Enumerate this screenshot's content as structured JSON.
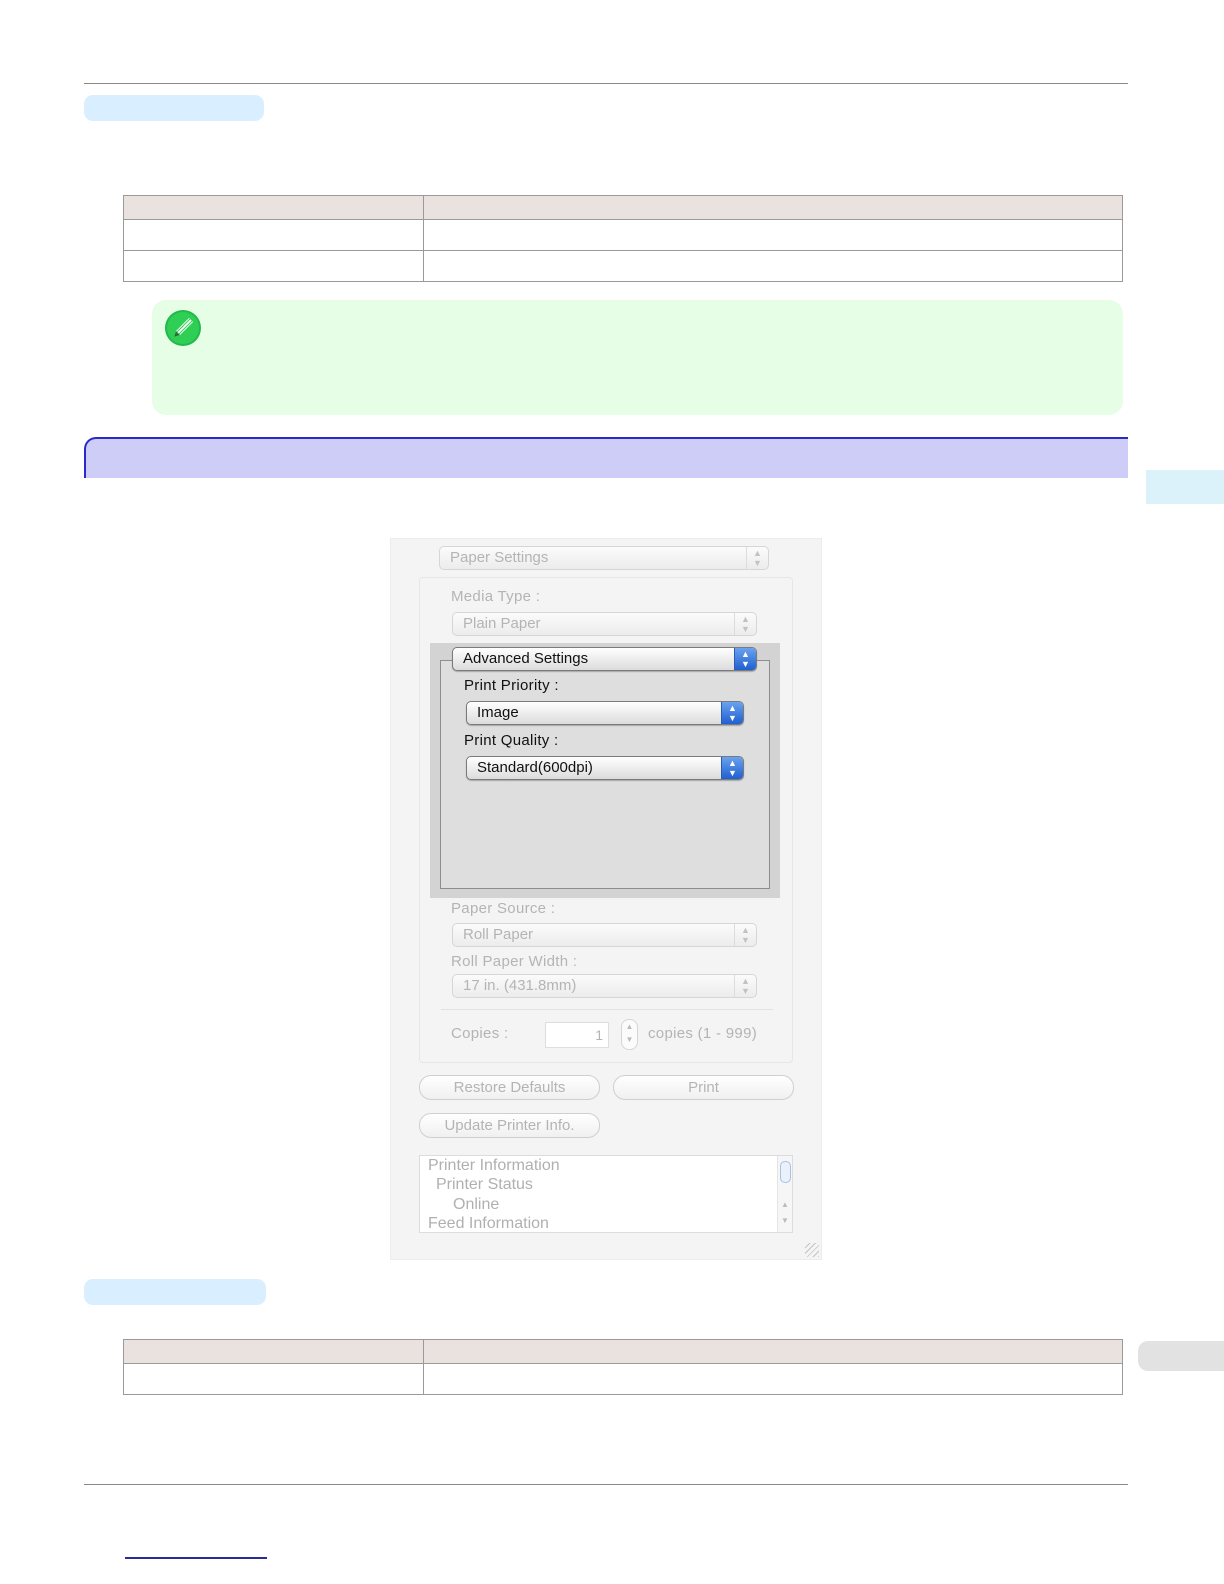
{
  "dialog": {
    "panel_popup": "Paper Settings",
    "media_type_label": "Media Type :",
    "media_type_value": "Plain Paper",
    "advanced_popup": "Advanced Settings",
    "print_priority_label": "Print Priority :",
    "print_priority_value": "Image",
    "print_quality_label": "Print Quality :",
    "print_quality_value": "Standard(600dpi)",
    "paper_source_label": "Paper Source :",
    "paper_source_value": "Roll Paper",
    "roll_width_label": "Roll Paper Width :",
    "roll_width_value": "17 in. (431.8mm)",
    "copies_label": "Copies :",
    "copies_value": "1",
    "copies_range": "copies (1 - 999)",
    "restore_defaults": "Restore Defaults",
    "print": "Print",
    "update_printer_info": "Update Printer Info.",
    "info_lines": [
      "Printer Information",
      "Printer Status",
      "Online",
      "Feed Information"
    ]
  },
  "icons": {
    "note": "pencil-note-icon",
    "popup_arrows": "up-down-arrows-icon",
    "resize": "resize-grip-icon"
  },
  "colors": {
    "section_bar": "#cdcdf8",
    "section_border": "#2a2ac8",
    "note_bg": "#e6fde6",
    "pill": "#d9efff",
    "table_header": "#e9e2de"
  }
}
